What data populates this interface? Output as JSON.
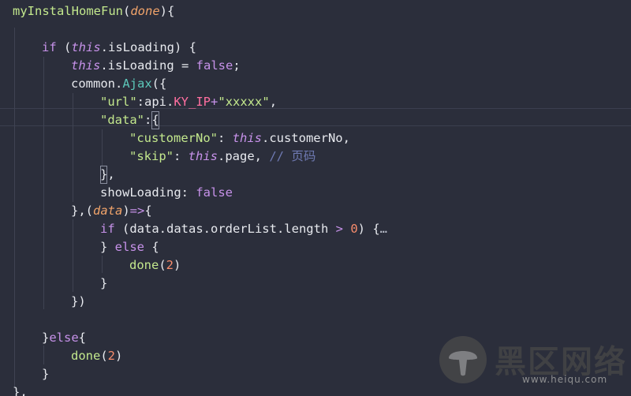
{
  "code": {
    "l1_fn": "myInstalHomeFun",
    "l1_param": "done",
    "l3_if": "if",
    "l3_this": "this",
    "l3_prop": ".isLoading) {",
    "l4_this": "this",
    "l4_prop": ".isLoading = ",
    "l4_false": "false",
    "l5_obj": "common.",
    "l5_fn": "Ajax",
    "l6_key": "\"url\"",
    "l6_api": "api.",
    "l6_const": "KY_IP",
    "l6_plus": "+",
    "l6_str": "\"xxxxx\"",
    "l7_key": "\"data\"",
    "l8_key": "\"customerNo\"",
    "l8_this": "this",
    "l8_prop": ".customerNo,",
    "l9_key": "\"skip\"",
    "l9_this": "this",
    "l9_prop": ".page, ",
    "l9_comment": "// 页码",
    "l11_key": "showLoading",
    "l11_false": "false",
    "l12_param": "data",
    "l13_if": "if",
    "l13_expr": " (data.datas.orderList.length ",
    "l13_op": ">",
    "l13_num": "0",
    "l13_fold": "…",
    "l14_else": "else",
    "l15_fn": "done",
    "l15_num": "2",
    "l19_else": "else",
    "l20_fn": "done",
    "l20_num": "2"
  },
  "watermark": {
    "title": "黑区网络",
    "url": "www.heiqu.com"
  },
  "colors": {
    "background": "#2b2e3b",
    "function": "#c3e88d",
    "method": "#5cc7b9",
    "keyword": "#c792ea",
    "parameter": "#f0a36a",
    "number": "#f78c6c",
    "constant": "#ff6fa0",
    "comment": "#6f7ab3"
  }
}
